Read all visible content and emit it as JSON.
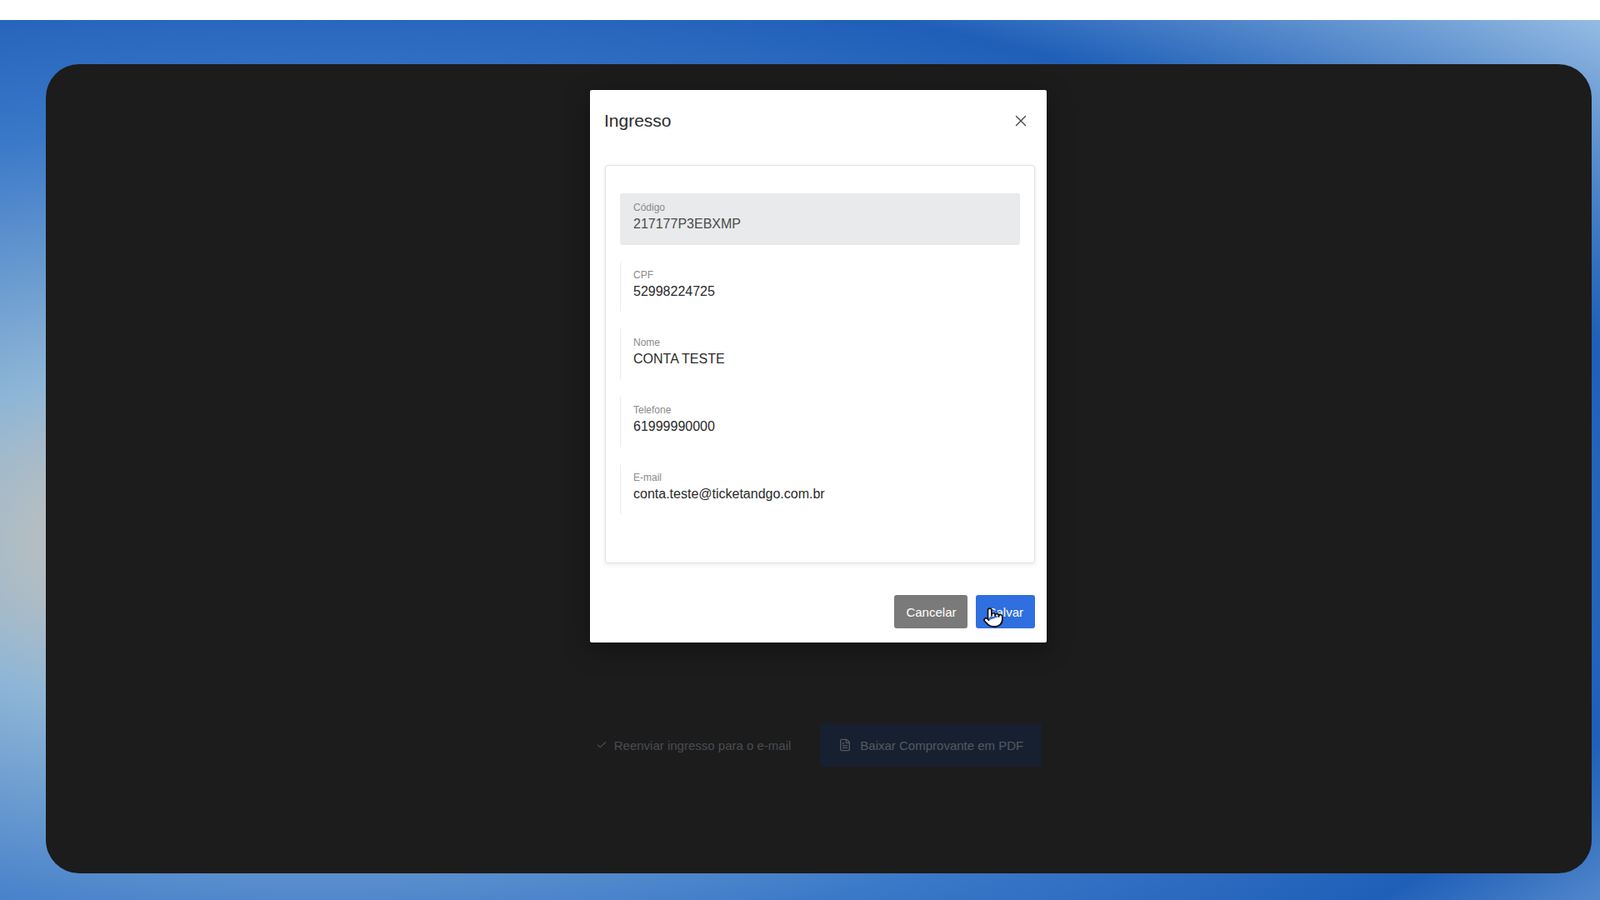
{
  "background_actions": {
    "link": "Reenviar ingresso para o e-mail",
    "button": "Baixar Comprovante em PDF"
  },
  "modal": {
    "title": "Ingresso",
    "fields": [
      {
        "label": "Código",
        "value": "217177P3EBXMP",
        "disabled": true
      },
      {
        "label": "CPF",
        "value": "52998224725",
        "disabled": false
      },
      {
        "label": "Nome",
        "value": "CONTA TESTE",
        "disabled": false
      },
      {
        "label": "Telefone",
        "value": "61999990000",
        "disabled": false
      },
      {
        "label": "E-mail",
        "value": "conta.teste@ticketandgo.com.br",
        "disabled": false
      }
    ],
    "buttons": [
      {
        "label": "Cancelar",
        "kind": "secondary"
      },
      {
        "label": "Salvar",
        "kind": "primary"
      }
    ]
  }
}
